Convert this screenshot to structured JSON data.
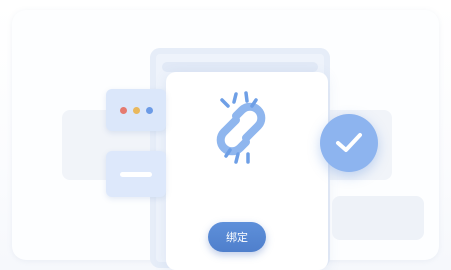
{
  "illustration": {
    "window_dots_colors": [
      "#e57a6f",
      "#e9b85c",
      "#6c9be6"
    ],
    "icons": [
      "broken-link-icon",
      "checkmark-icon",
      "window-dots-icon"
    ]
  },
  "actions": {
    "bind_label": "绑定"
  },
  "colors": {
    "accent": "#5a8ad6",
    "check_bg": "#8db4ef"
  }
}
